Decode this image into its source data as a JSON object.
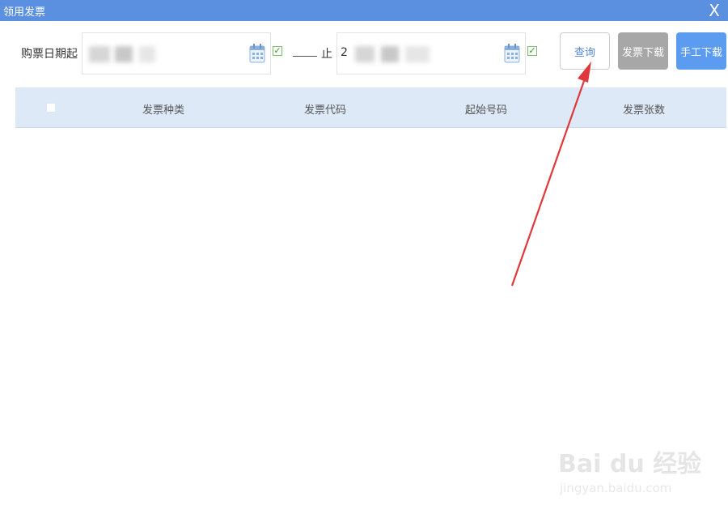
{
  "window": {
    "title": "领用发票",
    "close_glyph": "X"
  },
  "filters": {
    "start_label": "购票日期起",
    "start_value": "",
    "end_label": "止",
    "end_value_visible": "2",
    "start_checked": true,
    "end_checked": true
  },
  "buttons": {
    "query": "查询",
    "invoice_download": "发票下载",
    "manual_download": "手工下载"
  },
  "table": {
    "columns": [
      "发票种类",
      "发票代码",
      "起始号码",
      "发票张数"
    ],
    "rows": []
  },
  "watermark": {
    "logo": "Bai du 经验",
    "url": "jingyan.baidu.com"
  },
  "colors": {
    "titlebar": "#5b8fe0",
    "header_bg": "#dde9f7",
    "arrow": "#e0373a",
    "primary_button": "#5b9cf0",
    "gray_button": "#a7a7a7"
  }
}
